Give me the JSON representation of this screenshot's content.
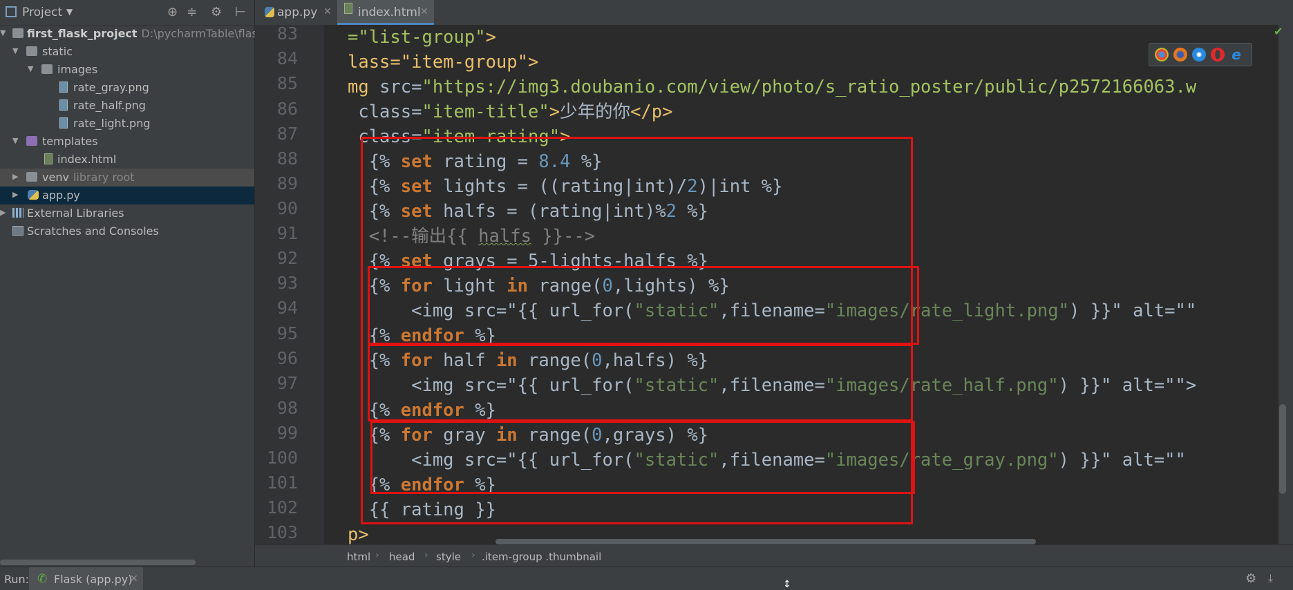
{
  "project": {
    "title": "Project",
    "tree": [
      {
        "label": "first_flask_project",
        "hint": "D:\\pycharmTable\\flask\\firs",
        "type": "project-root"
      },
      {
        "label": "static",
        "type": "folder"
      },
      {
        "label": "images",
        "type": "folder"
      },
      {
        "label": "rate_gray.png",
        "type": "image-file"
      },
      {
        "label": "rate_half.png",
        "type": "image-file"
      },
      {
        "label": "rate_light.png",
        "type": "image-file"
      },
      {
        "label": "templates",
        "type": "folder"
      },
      {
        "label": "index.html",
        "type": "html-file"
      },
      {
        "label": "venv",
        "hint": "library root",
        "type": "folder"
      },
      {
        "label": "app.py",
        "type": "python-file"
      },
      {
        "label": "External Libraries",
        "type": "libraries"
      },
      {
        "label": "Scratches and Consoles",
        "type": "scratches"
      }
    ]
  },
  "tabs": [
    {
      "label": "app.py",
      "active": false
    },
    {
      "label": "index.html",
      "active": true
    }
  ],
  "editor": {
    "line_numbers": [
      "83",
      "84",
      "85",
      "86",
      "87",
      "88",
      "89",
      "90",
      "91",
      "92",
      "93",
      "94",
      "95",
      "96",
      "97",
      "98",
      "99",
      "100",
      "101",
      "102",
      "103"
    ]
  },
  "code": {
    "l83": {
      "a": "=\"list-group\"",
      "b": ">"
    },
    "l84": {
      "a": "lass=\"item-group\"",
      "b": ">"
    },
    "l85": {
      "a": "mg",
      "b": " src=",
      "c": "\"https://img3.doubanio.com/view/photo/s_ratio_poster/public/p2572166063.w"
    },
    "l86": {
      "a": " class=",
      "b": "\"item-title\"",
      "c": ">",
      "d": "少年的你",
      "e": "</p>"
    },
    "l87": {
      "a": " class=",
      "b": "\"item-rating\"",
      "c": ">"
    },
    "l88": {
      "a": "  {% ",
      "b": "set",
      "c": " rating = ",
      "d": "8.4",
      "e": " %}"
    },
    "l89": {
      "a": "  {% ",
      "b": "set",
      "c": " lights = ((rating|int)/",
      "d": "2",
      "e": ")|int %}"
    },
    "l90": {
      "a": "  {% ",
      "b": "set",
      "c": " halfs = (rating|int)%",
      "d": "2",
      "e": " %}"
    },
    "l91": {
      "a": "  <!--输出{{ ",
      "b": "halfs",
      "c": " }}-->"
    },
    "l92": {
      "a": "  {% ",
      "b": "set",
      "c": " grays = 5-lights-halfs %}"
    },
    "l93": {
      "a": "  {% ",
      "b": "for",
      "c": " light ",
      "d": "in",
      "e": " range(",
      "f": "0",
      "g": ",lights) %}"
    },
    "l94": {
      "a": "      <img src=\"{{ url_for(",
      "b": "\"static\"",
      "c": ",filename=",
      "d": "\"images/rate_light.png\"",
      "e": ") }}\" alt=\"\""
    },
    "l95": {
      "a": "  {% ",
      "b": "endfor",
      "c": " %}"
    },
    "l96": {
      "a": "  {% ",
      "b": "for",
      "c": " half ",
      "d": "in",
      "e": " range(",
      "f": "0",
      "g": ",halfs) %}"
    },
    "l97": {
      "a": "      <img src=\"{{ url_for(",
      "b": "\"static\"",
      "c": ",filename=",
      "d": "\"images/rate_half.png\"",
      "e": ") }}\" alt=\"\">"
    },
    "l98": {
      "a": "  {% ",
      "b": "endfor",
      "c": " %}"
    },
    "l99": {
      "a": "  {% ",
      "b": "for",
      "c": " gray ",
      "d": "in",
      "e": " range(",
      "f": "0",
      "g": ",grays) %}"
    },
    "l100": {
      "a": "      <img src=\"{{ url_for(",
      "b": "\"static\"",
      "c": ",filename=",
      "d": "\"images/rate_gray.png\"",
      "e": ") }}\" alt=\"\""
    },
    "l101": {
      "a": "  {% ",
      "b": "endfor",
      "c": " %}"
    },
    "l102": {
      "a": "  {{ rating }}"
    },
    "l103": {
      "a": "p",
      "b": ">"
    }
  },
  "breadcrumb": [
    "html",
    "head",
    "style",
    ".item-group .thumbnail"
  ],
  "run": {
    "label": "Run:",
    "tab_label": "Flask (app.py)"
  },
  "browser_icons": [
    "chrome-icon",
    "firefox-icon",
    "safari-icon",
    "opera-icon",
    "ie-icon"
  ],
  "colors": {
    "annotation_box": "#e01212",
    "keyword": "#cc7832",
    "string": "#6a8759",
    "number": "#6897bb",
    "tag": "#e8bf6a"
  }
}
